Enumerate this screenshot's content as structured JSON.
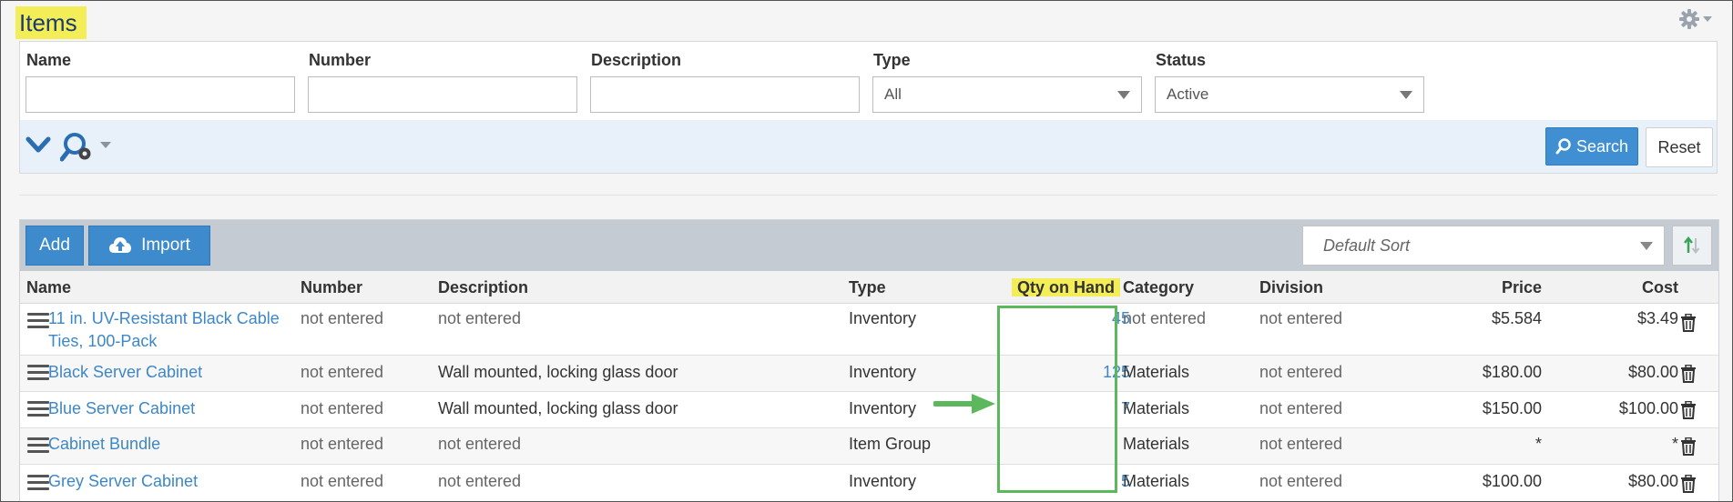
{
  "page": {
    "title": "Items"
  },
  "filters": {
    "fields": [
      {
        "label": "Name",
        "value": ""
      },
      {
        "label": "Number",
        "value": ""
      },
      {
        "label": "Description",
        "value": ""
      }
    ],
    "type": {
      "label": "Type",
      "value": "All"
    },
    "status": {
      "label": "Status",
      "value": "Active"
    },
    "search_label": "Search",
    "reset_label": "Reset"
  },
  "toolbar": {
    "add_label": "Add",
    "import_label": "Import",
    "sort_value": "Default Sort"
  },
  "table": {
    "columns": {
      "name": "Name",
      "number": "Number",
      "description": "Description",
      "type": "Type",
      "qty": "Qty on Hand",
      "category": "Category",
      "division": "Division",
      "price": "Price",
      "cost": "Cost"
    },
    "rows": [
      {
        "name_line1": "11 in. UV-Resistant Black Cable",
        "name_line2": "Ties, 100-Pack",
        "number": "not entered",
        "description": "not entered",
        "type": "Inventory",
        "qty": "45",
        "category": "not entered",
        "division": "not entered",
        "price": "$5.584",
        "cost": "$3.49"
      },
      {
        "name_line1": "Black Server Cabinet",
        "number": "not entered",
        "description": "Wall mounted, locking glass door",
        "type": "Inventory",
        "qty": "125",
        "category": "Materials",
        "division": "not entered",
        "price": "$180.00",
        "cost": "$80.00"
      },
      {
        "name_line1": "Blue Server Cabinet",
        "number": "not entered",
        "description": "Wall mounted, locking glass door",
        "type": "Inventory",
        "qty": "7",
        "category": "Materials",
        "division": "not entered",
        "price": "$150.00",
        "cost": "$100.00"
      },
      {
        "name_line1": "Cabinet Bundle",
        "number": "not entered",
        "description": "not entered",
        "type": "Item Group",
        "qty": "",
        "category": "Materials",
        "division": "not entered",
        "price": "*",
        "cost": "*"
      },
      {
        "name_line1": "Grey Server Cabinet",
        "number": "not entered",
        "description": "not entered",
        "type": "Inventory",
        "qty": "5",
        "category": "Materials",
        "division": "not entered",
        "price": "$100.00",
        "cost": "$80.00"
      }
    ]
  },
  "colors": {
    "highlight": "#f3ee58",
    "primary": "#3d8bcd",
    "link": "#3d87c7",
    "annotation": "#5cb85c",
    "filter_bar": "#e8f0fa",
    "toolbar": "#c5cbd3"
  },
  "icons": [
    "gear-icon",
    "chevron-down-icon",
    "search-settings-icon",
    "cloud-upload-icon",
    "sort-direction-icon",
    "drag-handle-icon",
    "trash-icon"
  ]
}
